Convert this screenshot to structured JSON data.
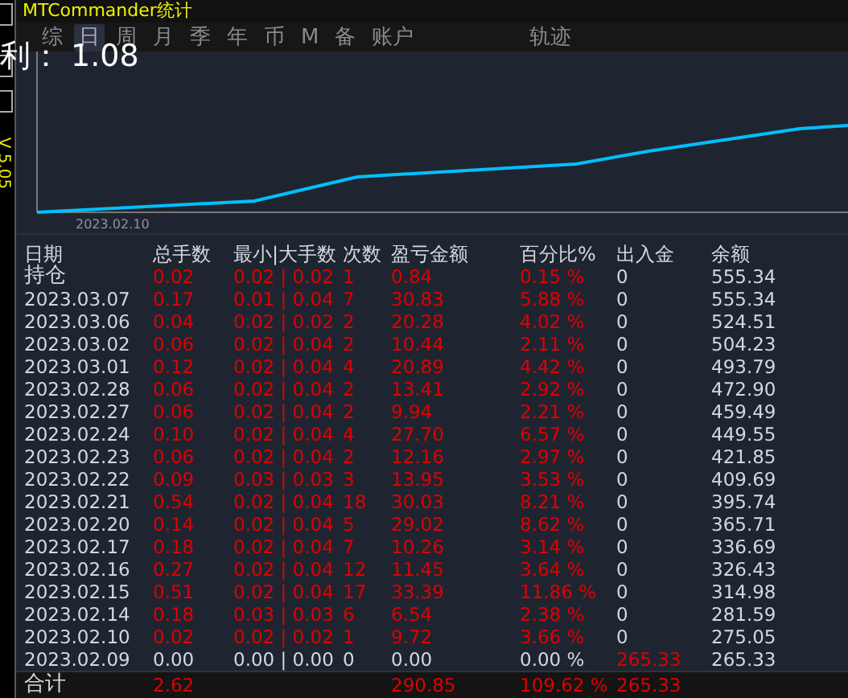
{
  "window": {
    "title": "MTCommander统计"
  },
  "side_strip": {
    "version": "V 5.05"
  },
  "tabs": [
    {
      "label": "综",
      "selected": false
    },
    {
      "label": "日",
      "selected": true
    },
    {
      "label": "周",
      "selected": false
    },
    {
      "label": "月",
      "selected": false
    },
    {
      "label": "季",
      "selected": false
    },
    {
      "label": "年",
      "selected": false
    },
    {
      "label": "币",
      "selected": false
    },
    {
      "label": "M",
      "selected": false
    },
    {
      "label": "备",
      "selected": false
    },
    {
      "label": "账户",
      "selected": false
    },
    {
      "label": "轨迹",
      "selected": false
    }
  ],
  "profit_overlay": "利： 1.08",
  "chart": {
    "x_label": "2023.02.10"
  },
  "table": {
    "columns": [
      "日期",
      "总手数",
      "最小|大手数",
      "次数",
      "盈亏金额",
      "百分比%",
      "出入金",
      "余额"
    ],
    "rows": [
      {
        "cells": [
          "持仓",
          "0.02",
          "0.02 | 0.02",
          "1",
          "0.84",
          "0.15 %",
          "0",
          "555.34"
        ],
        "gain": true,
        "deposit": false
      },
      {
        "cells": [
          "2023.03.07",
          "0.17",
          "0.01 | 0.04",
          "7",
          "30.83",
          "5.88 %",
          "0",
          "555.34"
        ],
        "gain": true,
        "deposit": false
      },
      {
        "cells": [
          "2023.03.06",
          "0.04",
          "0.02 | 0.02",
          "2",
          "20.28",
          "4.02 %",
          "0",
          "524.51"
        ],
        "gain": true,
        "deposit": false
      },
      {
        "cells": [
          "2023.03.02",
          "0.06",
          "0.02 | 0.04",
          "2",
          "10.44",
          "2.11 %",
          "0",
          "504.23"
        ],
        "gain": true,
        "deposit": false
      },
      {
        "cells": [
          "2023.03.01",
          "0.12",
          "0.02 | 0.04",
          "4",
          "20.89",
          "4.42 %",
          "0",
          "493.79"
        ],
        "gain": true,
        "deposit": false
      },
      {
        "cells": [
          "2023.02.28",
          "0.06",
          "0.02 | 0.04",
          "2",
          "13.41",
          "2.92 %",
          "0",
          "472.90"
        ],
        "gain": true,
        "deposit": false
      },
      {
        "cells": [
          "2023.02.27",
          "0.06",
          "0.02 | 0.04",
          "2",
          "9.94",
          "2.21 %",
          "0",
          "459.49"
        ],
        "gain": true,
        "deposit": false
      },
      {
        "cells": [
          "2023.02.24",
          "0.10",
          "0.02 | 0.04",
          "4",
          "27.70",
          "6.57 %",
          "0",
          "449.55"
        ],
        "gain": true,
        "deposit": false
      },
      {
        "cells": [
          "2023.02.23",
          "0.06",
          "0.02 | 0.04",
          "2",
          "12.16",
          "2.97 %",
          "0",
          "421.85"
        ],
        "gain": true,
        "deposit": false
      },
      {
        "cells": [
          "2023.02.22",
          "0.09",
          "0.03 | 0.03",
          "3",
          "13.95",
          "3.53 %",
          "0",
          "409.69"
        ],
        "gain": true,
        "deposit": false
      },
      {
        "cells": [
          "2023.02.21",
          "0.54",
          "0.02 | 0.04",
          "18",
          "30.03",
          "8.21 %",
          "0",
          "395.74"
        ],
        "gain": true,
        "deposit": false
      },
      {
        "cells": [
          "2023.02.20",
          "0.14",
          "0.02 | 0.04",
          "5",
          "29.02",
          "8.62 %",
          "0",
          "365.71"
        ],
        "gain": true,
        "deposit": false
      },
      {
        "cells": [
          "2023.02.17",
          "0.18",
          "0.02 | 0.04",
          "7",
          "10.26",
          "3.14 %",
          "0",
          "336.69"
        ],
        "gain": true,
        "deposit": false
      },
      {
        "cells": [
          "2023.02.16",
          "0.27",
          "0.02 | 0.04",
          "12",
          "11.45",
          "3.64 %",
          "0",
          "326.43"
        ],
        "gain": true,
        "deposit": false
      },
      {
        "cells": [
          "2023.02.15",
          "0.51",
          "0.02 | 0.04",
          "17",
          "33.39",
          "11.86 %",
          "0",
          "314.98"
        ],
        "gain": true,
        "deposit": false
      },
      {
        "cells": [
          "2023.02.14",
          "0.18",
          "0.03 | 0.03",
          "6",
          "6.54",
          "2.38 %",
          "0",
          "281.59"
        ],
        "gain": true,
        "deposit": false
      },
      {
        "cells": [
          "2023.02.10",
          "0.02",
          "0.02 | 0.02",
          "1",
          "9.72",
          "3.66 %",
          "0",
          "275.05"
        ],
        "gain": true,
        "deposit": false
      },
      {
        "cells": [
          "2023.02.09",
          "0.00",
          "0.00 | 0.00",
          "0",
          "0.00",
          "0.00 %",
          "265.33",
          "265.33"
        ],
        "gain": false,
        "deposit": true
      }
    ],
    "total": {
      "label": "合计",
      "lots": "2.62",
      "profit": "290.85",
      "percent": "109.62 %",
      "deposit": "265.33"
    }
  }
}
